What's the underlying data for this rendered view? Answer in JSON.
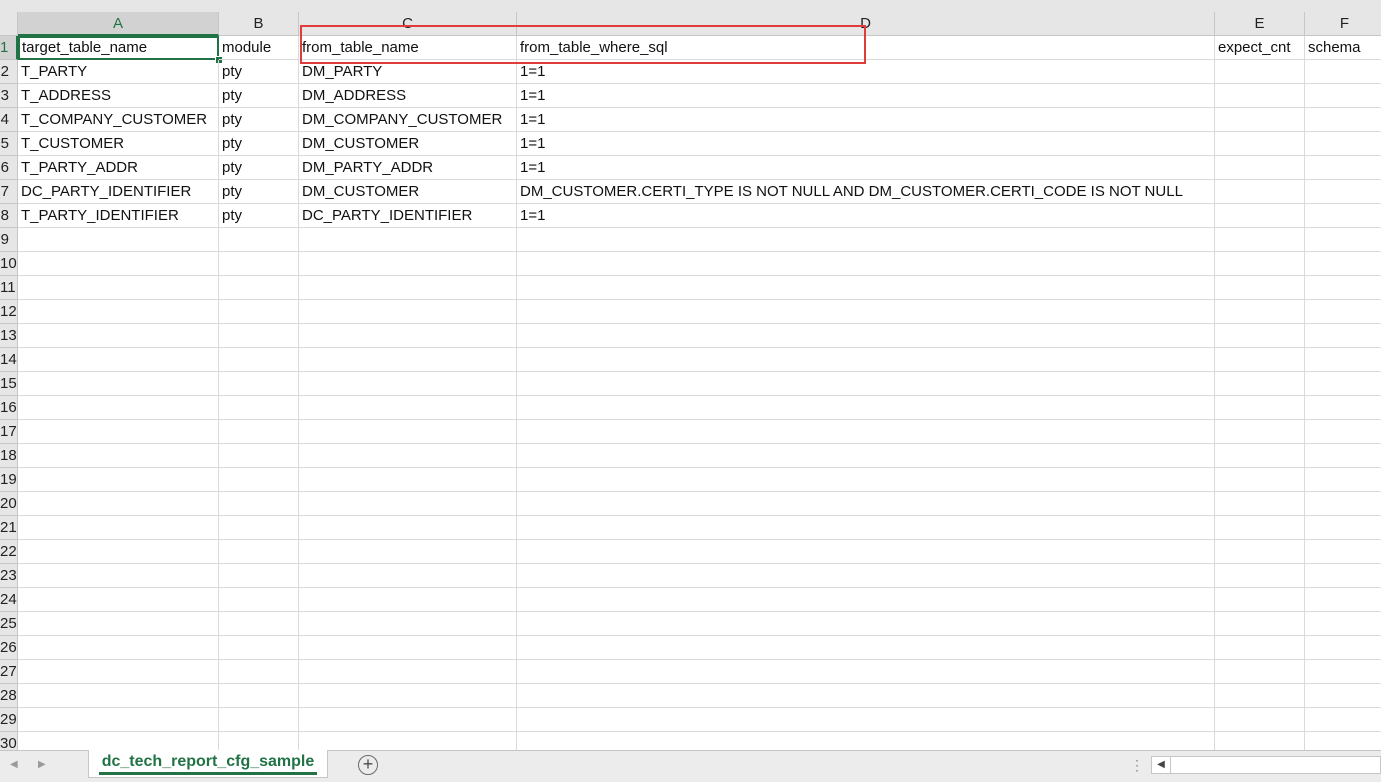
{
  "columns": [
    "A",
    "B",
    "C",
    "D",
    "E",
    "F"
  ],
  "selected_column": "A",
  "row_numbers": [
    "1",
    "2",
    "3",
    "4",
    "5",
    "6",
    "7",
    "8",
    "9",
    "10",
    "11",
    "12",
    "13",
    "14",
    "15",
    "16",
    "17",
    "18",
    "19",
    "20",
    "21",
    "22",
    "23",
    "24",
    "25",
    "26",
    "27",
    "28",
    "29",
    "30"
  ],
  "selected_row": "1",
  "active_cell": "A1",
  "rows": [
    [
      "target_table_name",
      "module",
      "from_table_name",
      "from_table_where_sql",
      "expect_cnt",
      "schema"
    ],
    [
      "T_PARTY",
      "pty",
      "DM_PARTY",
      "1=1",
      "",
      ""
    ],
    [
      "T_ADDRESS",
      "pty",
      "DM_ADDRESS",
      "1=1",
      "",
      ""
    ],
    [
      "T_COMPANY_CUSTOMER",
      "pty",
      "DM_COMPANY_CUSTOMER",
      "1=1",
      "",
      ""
    ],
    [
      "T_CUSTOMER",
      "pty",
      "DM_CUSTOMER",
      "1=1",
      "",
      ""
    ],
    [
      "T_PARTY_ADDR",
      "pty",
      "DM_PARTY_ADDR",
      "1=1",
      "",
      ""
    ],
    [
      "DC_PARTY_IDENTIFIER",
      "pty",
      "DM_CUSTOMER",
      "DM_CUSTOMER.CERTI_TYPE IS NOT NULL AND  DM_CUSTOMER.CERTI_CODE IS NOT NULL",
      "",
      ""
    ],
    [
      "T_PARTY_IDENTIFIER",
      "pty",
      "DC_PARTY_IDENTIFIER",
      "1=1",
      "",
      ""
    ]
  ],
  "sheet_tab": {
    "label": "dc_tech_report_cfg_sample"
  },
  "add_sheet": {
    "label": "+"
  },
  "colors": {
    "accent": "#217346",
    "annotation": "#e03c3c"
  },
  "icons": {
    "prev_sheet": "chevron-left-icon",
    "next_sheet": "chevron-right-icon",
    "add_sheet": "plus-circle-icon",
    "splitter": "vertical-dots-icon"
  }
}
